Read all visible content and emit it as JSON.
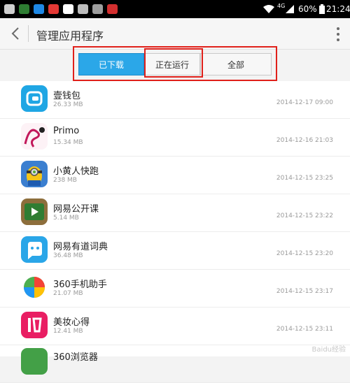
{
  "status_bar": {
    "network": "4G",
    "battery": "60%",
    "time": "21:24"
  },
  "header": {
    "title": "管理应用程序"
  },
  "tabs": [
    {
      "label": "已下载",
      "active": true
    },
    {
      "label": "正在运行",
      "active": false
    },
    {
      "label": "全部",
      "active": false
    }
  ],
  "apps": [
    {
      "name": "壹钱包",
      "size": "26.33 MB",
      "date": "2014-12-17 09:00",
      "icon": "wallet-app-icon",
      "color": "#1fa6e4"
    },
    {
      "name": "Primo",
      "size": "15.34 MB",
      "date": "2014-12-16 21:03",
      "icon": "primo-app-icon",
      "color": "#c2185b"
    },
    {
      "name": "小黄人快跑",
      "size": "238 MB",
      "date": "2014-12-15 23:25",
      "icon": "minion-app-icon",
      "color": "#f5c518"
    },
    {
      "name": "网易公开课",
      "size": "5.14 MB",
      "date": "2014-12-15 23:22",
      "icon": "open-course-app-icon",
      "color": "#2f7d32"
    },
    {
      "name": "网易有道词典",
      "size": "36.48 MB",
      "date": "2014-12-15 23:20",
      "icon": "youdao-dict-app-icon",
      "color": "#2aa6e8"
    },
    {
      "name": "360手机助手",
      "size": "21.07 MB",
      "date": "2014-12-15 23:17",
      "icon": "360-assistant-app-icon",
      "color": "#4caf50"
    },
    {
      "name": "美妆心得",
      "size": "12.41 MB",
      "date": "2014-12-15 23:11",
      "icon": "makeup-app-icon",
      "color": "#e91e63"
    },
    {
      "name": "360浏览器",
      "size": "",
      "date": "",
      "icon": "360-browser-app-icon",
      "color": "#43a047"
    }
  ],
  "watermark": "Baidu经验"
}
